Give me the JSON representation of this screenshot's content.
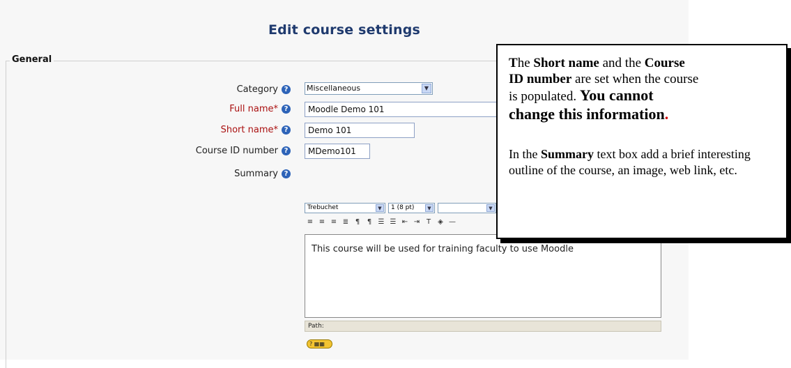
{
  "page": {
    "title": "Edit course settings"
  },
  "general": {
    "legend": "General"
  },
  "form": {
    "category": {
      "label": "Category",
      "value": "Miscellaneous"
    },
    "full_name": {
      "label": "Full name*",
      "value": "Moodle Demo 101"
    },
    "short_name": {
      "label": "Short name*",
      "value": "Demo 101"
    },
    "course_id": {
      "label": "Course ID number",
      "value": "MDemo101"
    },
    "summary": {
      "label": "Summary"
    }
  },
  "editor": {
    "font_family": "Trebuchet",
    "font_size": "1 (8 pt)",
    "format": "",
    "content": "This course will be used for training faculty to use Moodle",
    "path_label": "Path:"
  },
  "callout": {
    "line1_a": "T",
    "line1_b": "he ",
    "line1_c": "Short name",
    "line1_d": " and the ",
    "line1_e": "Course",
    "line2_a": "ID number",
    "line2_b": " are set when the course",
    "line3": "is populated.",
    "line3_bold": " You cannot",
    "line4": "change this information",
    "line4_dot": ".",
    "para2_a": "In the ",
    "para2_b": "Summary",
    "para2_c": " text box add a brief interesting outline of the course, an image, web link, etc."
  },
  "colors": {
    "title": "#1f3a6e",
    "required": "#aa1111",
    "help": "#2d63b8",
    "accent_red": "#d10000"
  }
}
